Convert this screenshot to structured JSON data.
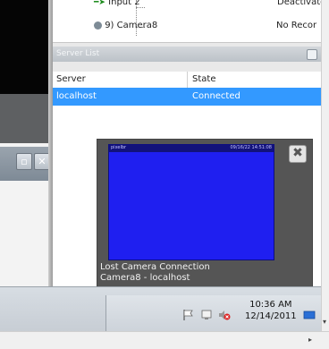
{
  "tree": {
    "row1_label": "Input 2",
    "row1_status": "Deactivate",
    "row2_label": "9) Camera8",
    "row2_status": "No Recor"
  },
  "server_list": {
    "title": "Server List",
    "columns": [
      "Server",
      "State"
    ],
    "rows": [
      {
        "server": "localhost",
        "state": "Connected"
      }
    ]
  },
  "popup": {
    "header_left": "pixelbr",
    "header_right": "09/16/22 14:51:08",
    "message_line1": "Lost Camera Connection",
    "message_line2": "Camera8 - localhost",
    "close_glyph": "✖"
  },
  "taskbar": {
    "time": "10:36 AM",
    "date": "12/14/2011"
  },
  "colors": {
    "selection": "#3399ff",
    "video": "#1f1ff0"
  }
}
